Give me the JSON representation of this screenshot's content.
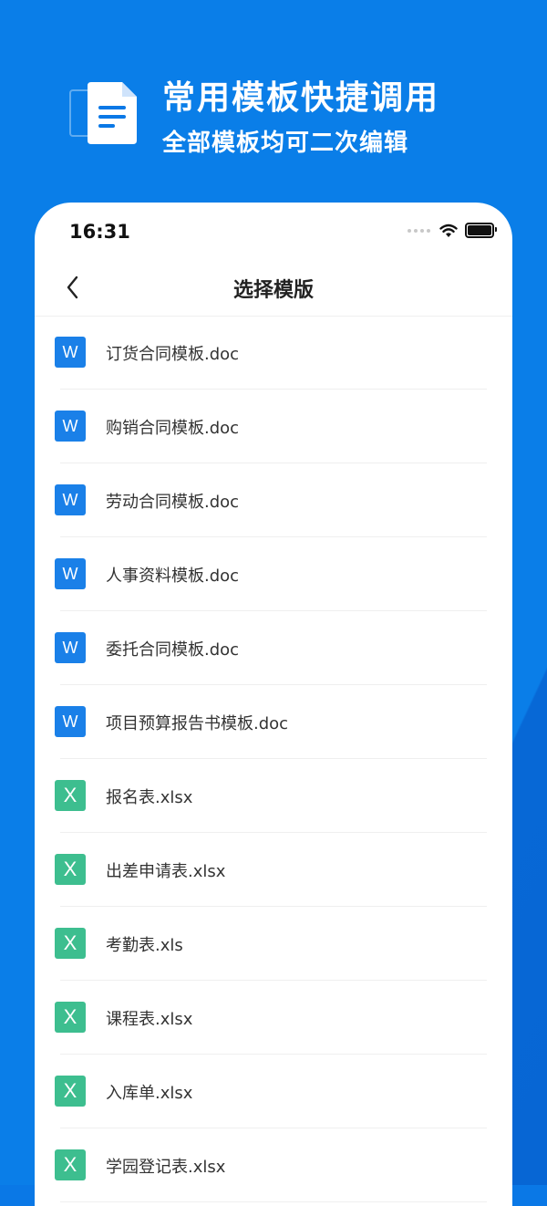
{
  "hero": {
    "title": "常用模板快捷调用",
    "subtitle": "全部模板均可二次编辑",
    "icon": "document-icon"
  },
  "status_bar": {
    "time": "16:31"
  },
  "nav": {
    "title": "选择模版",
    "back_icon": "chevron-left-icon"
  },
  "colors": {
    "background": "#0a78e6",
    "word_badge": "#1a80e8",
    "excel_badge": "#3dbe8f"
  },
  "files": [
    {
      "type": "word",
      "badge": "W",
      "name": "订货合同模板.doc"
    },
    {
      "type": "word",
      "badge": "W",
      "name": "购销合同模板.doc"
    },
    {
      "type": "word",
      "badge": "W",
      "name": "劳动合同模板.doc"
    },
    {
      "type": "word",
      "badge": "W",
      "name": "人事资料模板.doc"
    },
    {
      "type": "word",
      "badge": "W",
      "name": "委托合同模板.doc"
    },
    {
      "type": "word",
      "badge": "W",
      "name": "项目预算报告书模板.doc"
    },
    {
      "type": "excel",
      "badge": "X",
      "name": "报名表.xlsx"
    },
    {
      "type": "excel",
      "badge": "X",
      "name": "出差申请表.xlsx"
    },
    {
      "type": "excel",
      "badge": "X",
      "name": "考勤表.xls"
    },
    {
      "type": "excel",
      "badge": "X",
      "name": "课程表.xlsx"
    },
    {
      "type": "excel",
      "badge": "X",
      "name": "入库单.xlsx"
    },
    {
      "type": "excel",
      "badge": "X",
      "name": "学园登记表.xlsx"
    }
  ]
}
